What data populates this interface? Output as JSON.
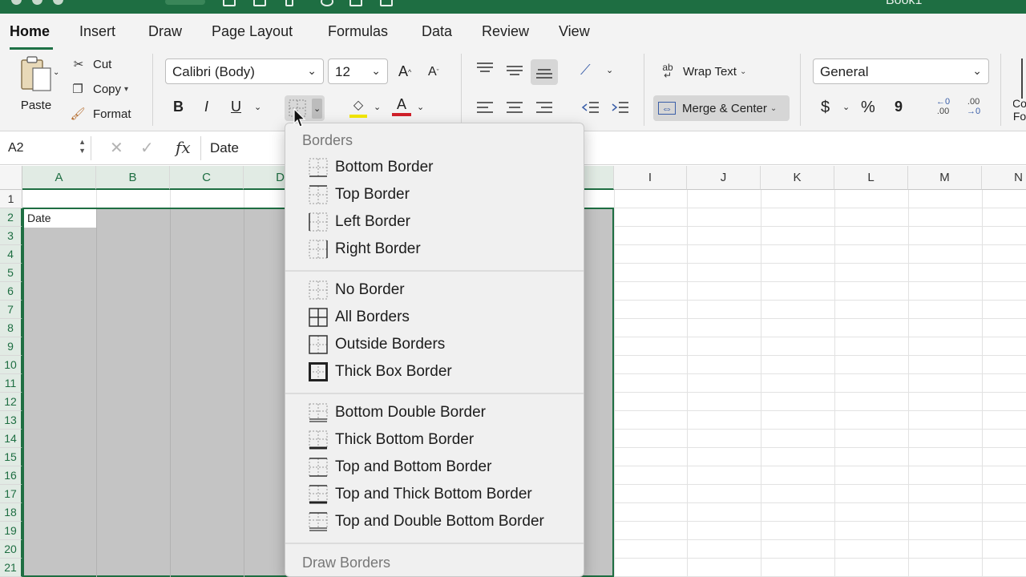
{
  "window": {
    "title": "Book1"
  },
  "ribbon": {
    "tabs": [
      {
        "label": "Home"
      },
      {
        "label": "Insert"
      },
      {
        "label": "Draw"
      },
      {
        "label": "Page Layout"
      },
      {
        "label": "Formulas"
      },
      {
        "label": "Data"
      },
      {
        "label": "Review"
      },
      {
        "label": "View"
      }
    ],
    "clipboard": {
      "paste": "Paste",
      "cut": "Cut",
      "copy": "Copy",
      "format": "Format"
    },
    "font": {
      "name": "Calibri (Body)",
      "size": "12",
      "bold": "B",
      "italic": "I",
      "underline": "U",
      "grow": "A",
      "shrink": "A",
      "color_letter": "A"
    },
    "alignment": {
      "wrap_text": "Wrap Text",
      "merge_center": "Merge & Center"
    },
    "number": {
      "format": "General",
      "currency": "$",
      "percent": "%",
      "comma": "9",
      "inc_decimal_top": "←0",
      "inc_decimal_bottom": ".00",
      "dec_decimal_top": ".00",
      "dec_decimal_bottom": "→0"
    },
    "cut_off_labels": {
      "top": "Co",
      "bottom": "Fo"
    }
  },
  "formula_bar": {
    "cell_ref": "A2",
    "fx": "fx",
    "value": "Date"
  },
  "grid": {
    "columns": [
      "A",
      "B",
      "C",
      "D",
      "I",
      "J",
      "K",
      "L",
      "M",
      "N"
    ],
    "rows": [
      "1",
      "2",
      "3",
      "4",
      "5",
      "6",
      "7",
      "8",
      "9",
      "10",
      "11",
      "12",
      "13",
      "14",
      "15",
      "16",
      "17",
      "18",
      "19",
      "20",
      "21"
    ],
    "active_cell_value": "Date"
  },
  "borders_menu": {
    "heading": "Borders",
    "group1": [
      "Bottom Border",
      "Top Border",
      "Left Border",
      "Right Border"
    ],
    "group2": [
      "No Border",
      "All Borders",
      "Outside Borders",
      "Thick Box Border"
    ],
    "group3": [
      "Bottom Double Border",
      "Thick Bottom Border",
      "Top and Bottom Border",
      "Top and Thick Bottom Border",
      "Top and Double Bottom Border"
    ],
    "draw_heading": "Draw Borders"
  },
  "colors": {
    "accent": "#1e6e42",
    "font_color_bar": "#d0202a",
    "highlight_bar": "#f2e600",
    "selection_fill": "#c4c4c4"
  }
}
